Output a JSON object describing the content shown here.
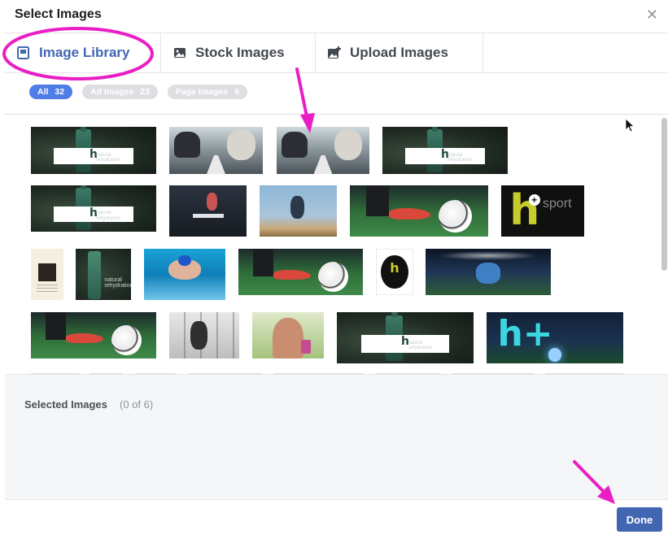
{
  "dialog": {
    "title": "Select Images",
    "close_glyph": "✕"
  },
  "tabs": [
    {
      "label": "Image Library",
      "icon": "image-library-icon",
      "active": true
    },
    {
      "label": "Stock Images",
      "icon": "stock-image-icon",
      "active": false
    },
    {
      "label": "Upload Images",
      "icon": "upload-image-icon",
      "active": false
    }
  ],
  "filters": [
    {
      "label": "All",
      "count": "32",
      "active": true
    },
    {
      "label": "Ad Images",
      "count": "23",
      "active": false
    },
    {
      "label": "Page Images",
      "count": "9",
      "active": false
    }
  ],
  "images": [
    {
      "subject": "hsport-bottle"
    },
    {
      "subject": "runner-shoes"
    },
    {
      "subject": "runner-shoes"
    },
    {
      "subject": "hsport-bottle"
    },
    {
      "subject": "hsport-bottle"
    },
    {
      "subject": "hurdler"
    },
    {
      "subject": "jumper"
    },
    {
      "subject": "soccer-boot"
    },
    {
      "subject": "hsport-logo-banner",
      "text_h": "h",
      "text_plus": "+",
      "text_sport": "sport"
    },
    {
      "subject": "document"
    },
    {
      "subject": "bottle"
    },
    {
      "subject": "swimmer"
    },
    {
      "subject": "soccer-boot"
    },
    {
      "subject": "round-logo",
      "text_h": "h"
    },
    {
      "subject": "goalkeeper"
    },
    {
      "subject": "soccer-boot"
    },
    {
      "subject": "gym"
    },
    {
      "subject": "woman-drink"
    },
    {
      "subject": "hsport-bottle"
    },
    {
      "subject": "field-logo",
      "text_h": "h+"
    }
  ],
  "selected": {
    "label": "Selected Images",
    "count_text": "(0 of 6)"
  },
  "footer": {
    "done_label": "Done"
  },
  "colors": {
    "brand_blue": "#4267b2",
    "active_pill": "#4e7de8",
    "annotation_magenta": "#e91fc5"
  }
}
